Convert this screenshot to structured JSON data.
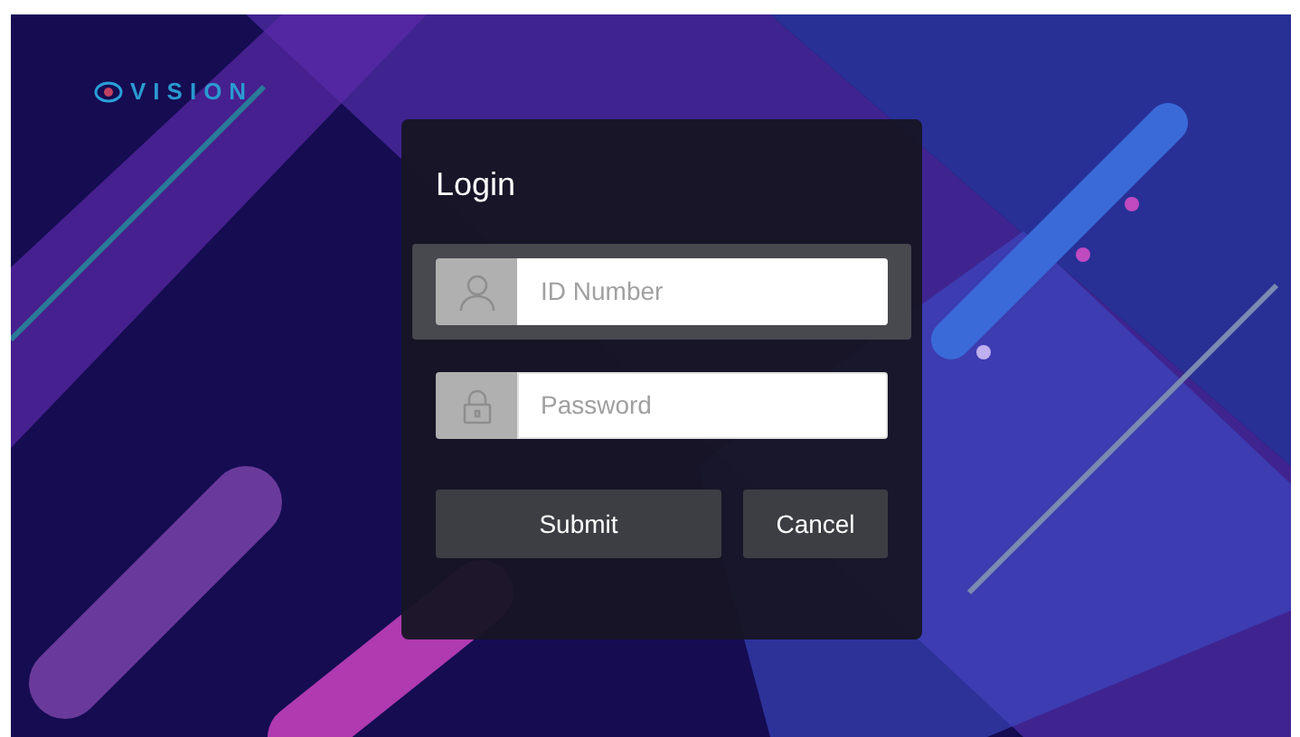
{
  "logo": {
    "text": "VISION"
  },
  "dialog": {
    "title": "Login",
    "fields": [
      {
        "kind": "user",
        "placeholder": "ID Number",
        "selected": true
      },
      {
        "kind": "lock",
        "placeholder": "Password",
        "selected": false
      }
    ],
    "buttons": [
      {
        "kind": "primary",
        "label": "Submit"
      },
      {
        "kind": "secondary",
        "label": "Cancel"
      }
    ]
  }
}
